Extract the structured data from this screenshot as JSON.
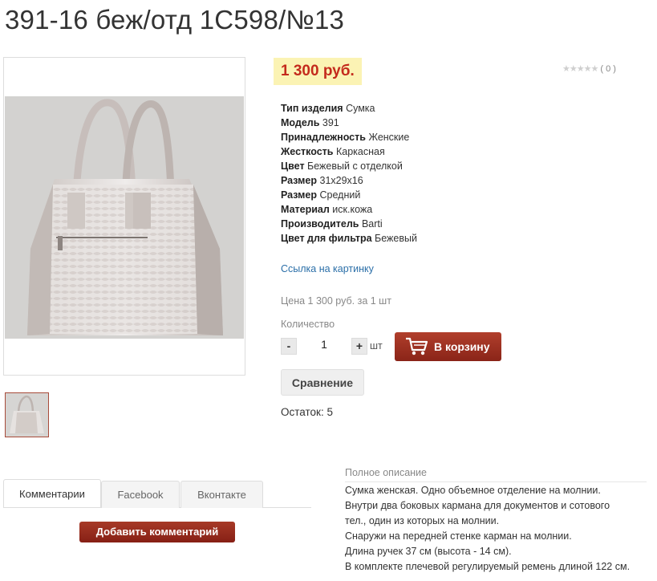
{
  "product": {
    "title": "391-16 беж/отд 1С598/№13",
    "price": "1 300 руб.",
    "rating": "( 0 )",
    "specs": [
      {
        "key": "Тип изделия",
        "value": "Сумка"
      },
      {
        "key": "Модель",
        "value": "391"
      },
      {
        "key": "Принадлежность",
        "value": "Женские"
      },
      {
        "key": "Жесткость",
        "value": "Каркасная"
      },
      {
        "key": "Цвет",
        "value": "Бежевый с отделкой"
      },
      {
        "key": "Размер",
        "value": "31x29x16"
      },
      {
        "key": "Размер",
        "value": "Средний"
      },
      {
        "key": "Материал",
        "value": "иск.кожа"
      },
      {
        "key": "Производитель",
        "value": "Barti"
      },
      {
        "key": "Цвет для фильтра",
        "value": "Бежевый"
      }
    ],
    "image_link": "Ссылка на картинку",
    "unit_price": "Цена 1 300 руб. за 1 шт",
    "quantity_label": "Количество",
    "quantity_minus": "-",
    "quantity_value": "1",
    "quantity_plus": "+",
    "quantity_unit": "шт",
    "cart_button": "В корзину",
    "compare_button": "Сравнение",
    "stock": "Остаток: 5"
  },
  "tabs": [
    {
      "label": "Комментарии",
      "active": true
    },
    {
      "label": "Facebook",
      "active": false
    },
    {
      "label": "Вконтакте",
      "active": false
    }
  ],
  "add_comment_button": "Добавить комментарий",
  "description": {
    "heading": "Полное описание",
    "lines": [
      "Сумка женская. Одно объемное отделение на молнии.",
      "Внутри два боковых кармана для документов и сотового",
      "тел., один из которых на молнии.",
      "Снаружи на передней стенке карман на молнии.",
      "Длина ручек 37 см (высота - 14 см).",
      "В комплекте плечевой регулируемый ремень длиной 122 см."
    ]
  },
  "colors": {
    "price_text": "#c42a1c",
    "price_bg": "#fbf3b4",
    "button_red": "#9a2f1f",
    "link": "#2b6fa8"
  }
}
